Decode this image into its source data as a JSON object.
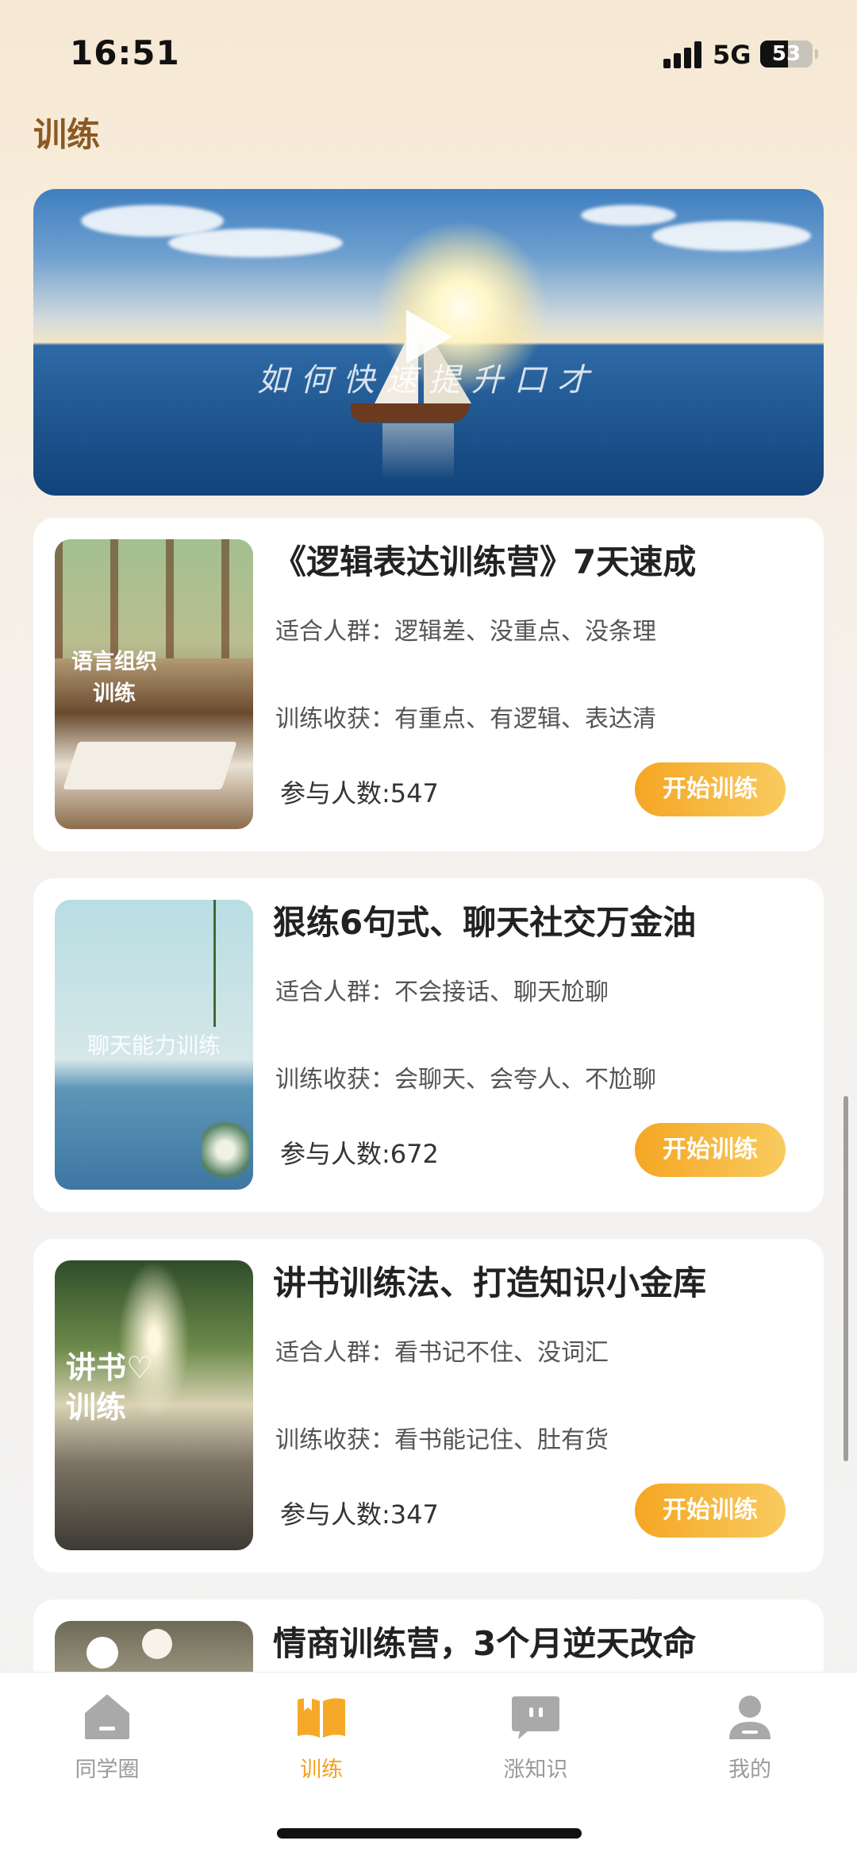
{
  "status_bar": {
    "time": "16:51",
    "network": "5G",
    "battery": "53",
    "battery_level_percent": 53
  },
  "page": {
    "title": "训练"
  },
  "banner": {
    "caption": "如何快速提升口才"
  },
  "courses": [
    {
      "title": "《逻辑表达训练营》7天速成",
      "audience": "适合人群：逻辑差、没重点、没条理",
      "gain": "训练收获：有重点、有逻辑、表达清",
      "participants": "参与人数:547",
      "button": "开始训练",
      "thumb_label": "语言组织\n训练"
    },
    {
      "title": "狠练6句式、聊天社交万金油",
      "audience": "适合人群：不会接话、聊天尬聊",
      "gain": "训练收获：会聊天、会夸人、不尬聊",
      "participants": "参与人数:672",
      "button": "开始训练",
      "thumb_label": "聊天能力训练"
    },
    {
      "title": "讲书训练法、打造知识小金库",
      "audience": "适合人群：看书记不住、没词汇",
      "gain": "训练收获：看书能记住、肚有货",
      "participants": "参与人数:347",
      "button": "开始训练",
      "thumb_label": "讲书♡\n训练"
    },
    {
      "title": "情商训练营，3个月逆天改命"
    }
  ],
  "tabs": [
    {
      "label": "同学圈",
      "icon": "home-icon",
      "active": false
    },
    {
      "label": "训练",
      "icon": "book-icon",
      "active": true
    },
    {
      "label": "涨知识",
      "icon": "chat-icon",
      "active": false
    },
    {
      "label": "我的",
      "icon": "user-icon",
      "active": false
    }
  ],
  "colors": {
    "accent": "#f5a623",
    "title_brown": "#8a5a22",
    "inactive_tab": "#9a9a9a"
  }
}
